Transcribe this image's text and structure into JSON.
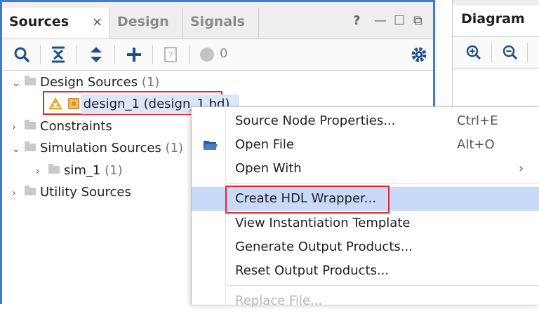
{
  "sources_panel": {
    "tabs": [
      {
        "label": "Sources",
        "close": "×"
      },
      {
        "label": "Design"
      },
      {
        "label": "Signals"
      }
    ],
    "window_controls": {
      "help": "?",
      "minimize": "—",
      "maximize": "☐",
      "restore": "⧉"
    },
    "toolbar": {
      "count_label": "0"
    },
    "tree": {
      "design_sources": {
        "label": "Design Sources",
        "count": "(1)"
      },
      "design_item": {
        "label": "design_1 (design_1.bd)"
      },
      "constraints": {
        "label": "Constraints"
      },
      "simulation_sources": {
        "label": "Simulation Sources",
        "count": "(1)"
      },
      "sim_1": {
        "label": "sim_1",
        "count": "(1)"
      },
      "utility_sources": {
        "label": "Utility Sources"
      }
    }
  },
  "diagram_panel": {
    "title": "Diagram"
  },
  "context_menu": {
    "items": [
      {
        "label": "Source Node Properties...",
        "shortcut": "Ctrl+E"
      },
      {
        "label": "Open File",
        "shortcut": "Alt+O"
      },
      {
        "label": "Open With",
        "submenu_arrow": "›"
      },
      {
        "label": "Create HDL Wrapper..."
      },
      {
        "label": "View Instantiation Template"
      },
      {
        "label": "Generate Output Products..."
      },
      {
        "label": "Reset Output Products..."
      },
      {
        "label": "Replace File..."
      }
    ]
  },
  "colors": {
    "panel_border": "#3d7bd6",
    "highlight_box": "#e0292f",
    "menu_highlight": "#c9daf8"
  }
}
